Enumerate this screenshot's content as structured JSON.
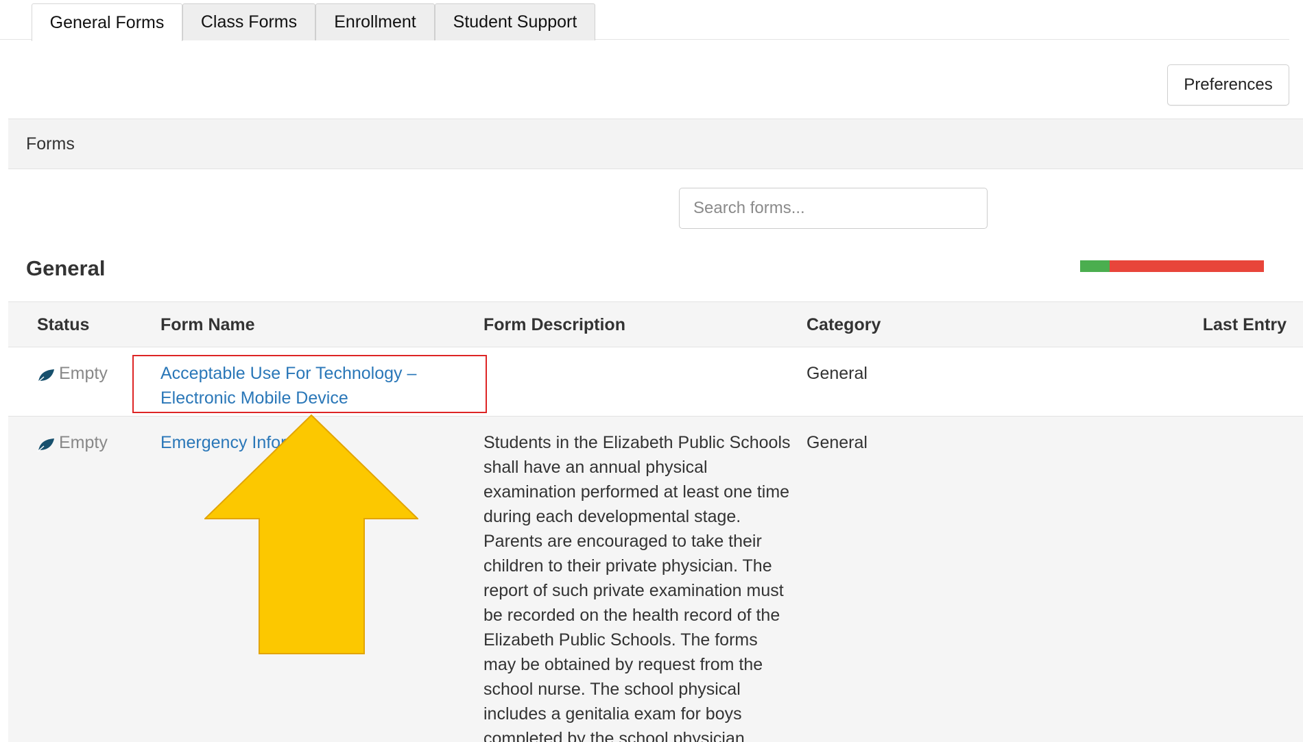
{
  "tabs": [
    {
      "label": "General Forms",
      "active": true
    },
    {
      "label": "Class Forms",
      "active": false
    },
    {
      "label": "Enrollment",
      "active": false
    },
    {
      "label": "Student Support",
      "active": false
    }
  ],
  "toolbar": {
    "preferences_label": "Preferences"
  },
  "forms_panel": {
    "title": "Forms"
  },
  "search": {
    "placeholder": "Search forms..."
  },
  "section": {
    "title": "General",
    "progress": {
      "complete_fraction": 0.16,
      "complete_color": "#4bae4f",
      "remaining_color": "#e8453a"
    }
  },
  "table": {
    "headers": {
      "status": "Status",
      "form_name": "Form Name",
      "form_description": "Form Description",
      "category": "Category",
      "last_entry": "Last Entry"
    },
    "rows": [
      {
        "status": "Empty",
        "status_icon": "leaf-icon",
        "form_name": "Acceptable Use For Technology – Electronic Mobile Device",
        "form_description": "",
        "category": "General",
        "last_entry": ""
      },
      {
        "status": "Empty",
        "status_icon": "leaf-icon",
        "form_name": "Emergency Infor",
        "form_description": "Students in the Elizabeth Public Schools shall have an annual physical examination performed at least one time during each developmental stage. Parents are encouraged to take their children to their private physician. The report of such private examination must be recorded on the health record of the Elizabeth Public Schools. The forms may be obtained by request from the school nurse. The school physical includes a genitalia exam for boys completed by the school physician.",
        "category": "General",
        "last_entry": ""
      }
    ]
  },
  "annotations": {
    "highlight_color": "#dd2424",
    "arrow_color": "#fcc800"
  }
}
